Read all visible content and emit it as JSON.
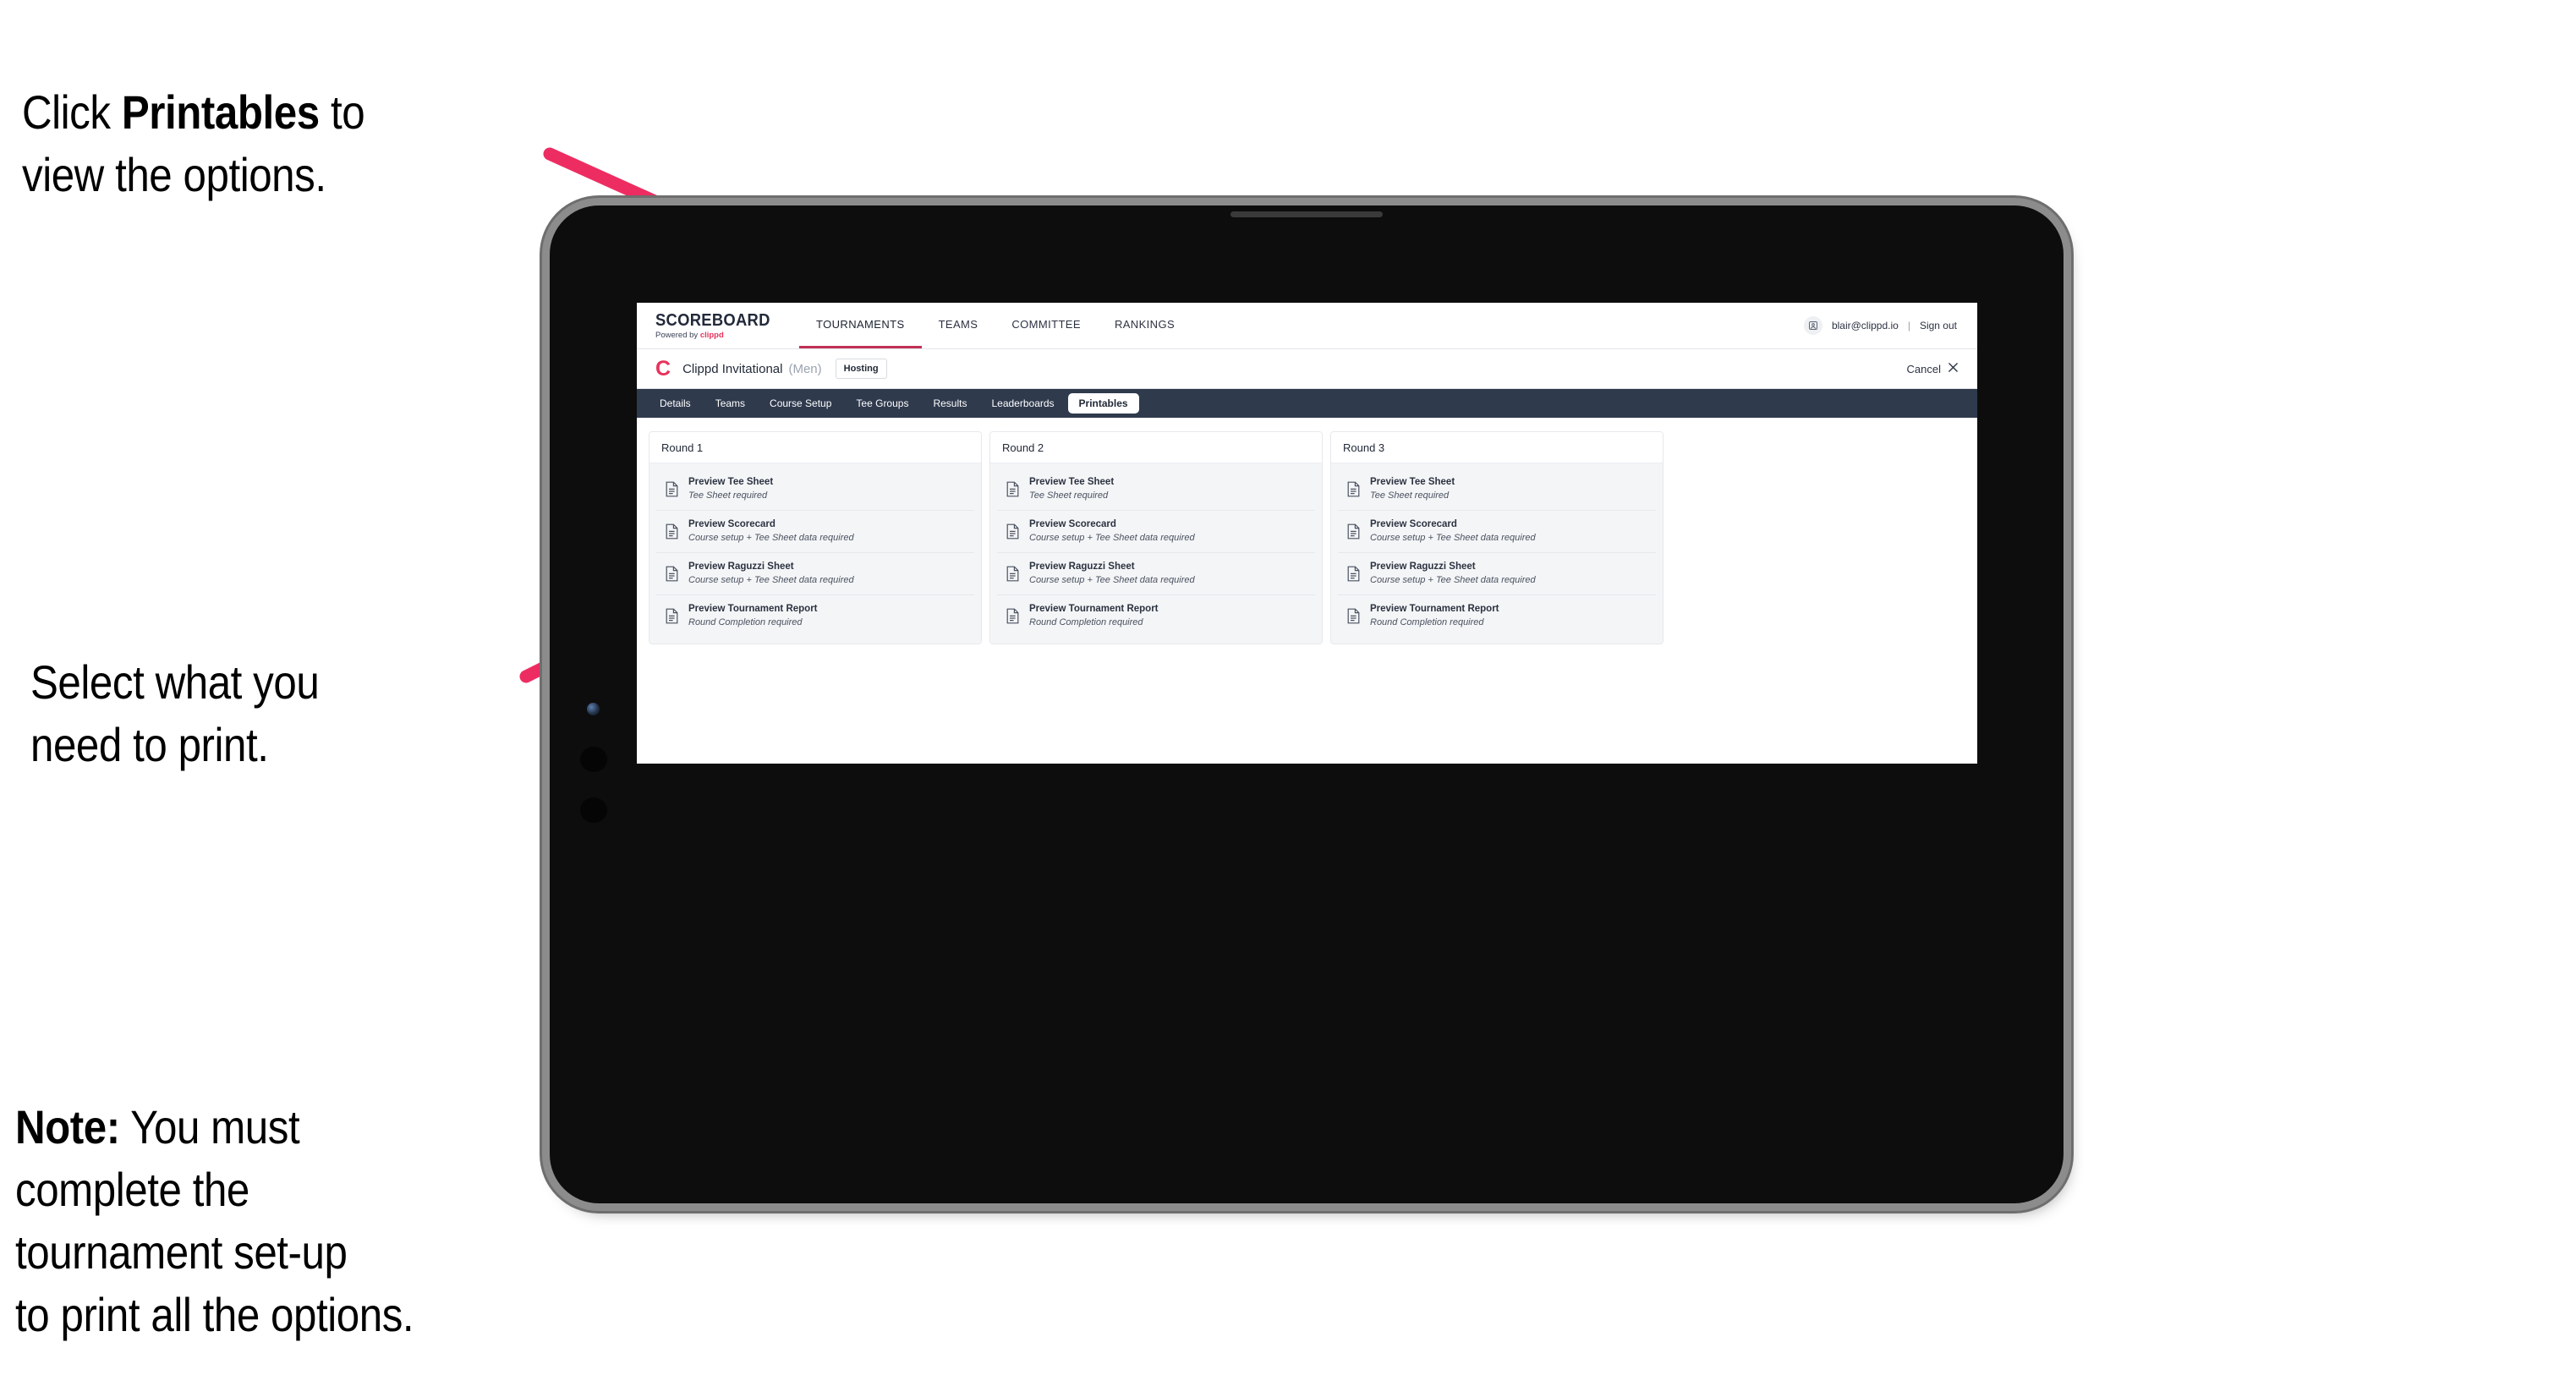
{
  "annotations": {
    "click_printables": {
      "prefix": "Click ",
      "bold": "Printables",
      "suffix": " to\nview the options."
    },
    "select_print": "Select what you\n need to print.",
    "note": {
      "bold": "Note:",
      "text": " You must\ncomplete the\ntournament set-up\nto print all the options."
    }
  },
  "colors": {
    "accent_pink": "#ED2D62",
    "brand_pink": "#E8325C",
    "tab_bar": "#2F3A4D",
    "active_tab_underline": "#C03055"
  },
  "app": {
    "brand": {
      "title": "SCOREBOARD",
      "sub_prefix": "Powered by ",
      "sub_accent": "clippd"
    },
    "top_nav": [
      {
        "label": "TOURNAMENTS",
        "active": true
      },
      {
        "label": "TEAMS",
        "active": false
      },
      {
        "label": "COMMITTEE",
        "active": false
      },
      {
        "label": "RANKINGS",
        "active": false
      }
    ],
    "account": {
      "avatar_icon": "user-avatar-icon",
      "email": "blair@clippd.io",
      "separator": "|",
      "sign_out": "Sign out"
    },
    "tournament_bar": {
      "logo": "C",
      "name": "Clippd Invitational",
      "gender": "(Men)",
      "status_badge": "Hosting",
      "cancel_label": "Cancel",
      "cancel_icon": "close-icon"
    },
    "tabs": [
      {
        "label": "Details",
        "active": false
      },
      {
        "label": "Teams",
        "active": false
      },
      {
        "label": "Course Setup",
        "active": false
      },
      {
        "label": "Tee Groups",
        "active": false
      },
      {
        "label": "Results",
        "active": false
      },
      {
        "label": "Leaderboards",
        "active": false
      },
      {
        "label": "Printables",
        "active": true
      }
    ],
    "rounds": [
      {
        "title": "Round 1",
        "items": [
          {
            "title": "Preview Tee Sheet",
            "sub": "Tee Sheet required",
            "icon": "document-icon"
          },
          {
            "title": "Preview Scorecard",
            "sub": "Course setup + Tee Sheet data required",
            "icon": "document-icon"
          },
          {
            "title": "Preview Raguzzi Sheet",
            "sub": "Course setup + Tee Sheet data required",
            "icon": "document-icon"
          },
          {
            "title": "Preview Tournament Report",
            "sub": "Round Completion required",
            "icon": "document-icon"
          }
        ]
      },
      {
        "title": "Round 2",
        "items": [
          {
            "title": "Preview Tee Sheet",
            "sub": "Tee Sheet required",
            "icon": "document-icon"
          },
          {
            "title": "Preview Scorecard",
            "sub": "Course setup + Tee Sheet data required",
            "icon": "document-icon"
          },
          {
            "title": "Preview Raguzzi Sheet",
            "sub": "Course setup + Tee Sheet data required",
            "icon": "document-icon"
          },
          {
            "title": "Preview Tournament Report",
            "sub": "Round Completion required",
            "icon": "document-icon"
          }
        ]
      },
      {
        "title": "Round 3",
        "items": [
          {
            "title": "Preview Tee Sheet",
            "sub": "Tee Sheet required",
            "icon": "document-icon"
          },
          {
            "title": "Preview Scorecard",
            "sub": "Course setup + Tee Sheet data required",
            "icon": "document-icon"
          },
          {
            "title": "Preview Raguzzi Sheet",
            "sub": "Course setup + Tee Sheet data required",
            "icon": "document-icon"
          },
          {
            "title": "Preview Tournament Report",
            "sub": "Round Completion required",
            "icon": "document-icon"
          }
        ]
      }
    ]
  }
}
